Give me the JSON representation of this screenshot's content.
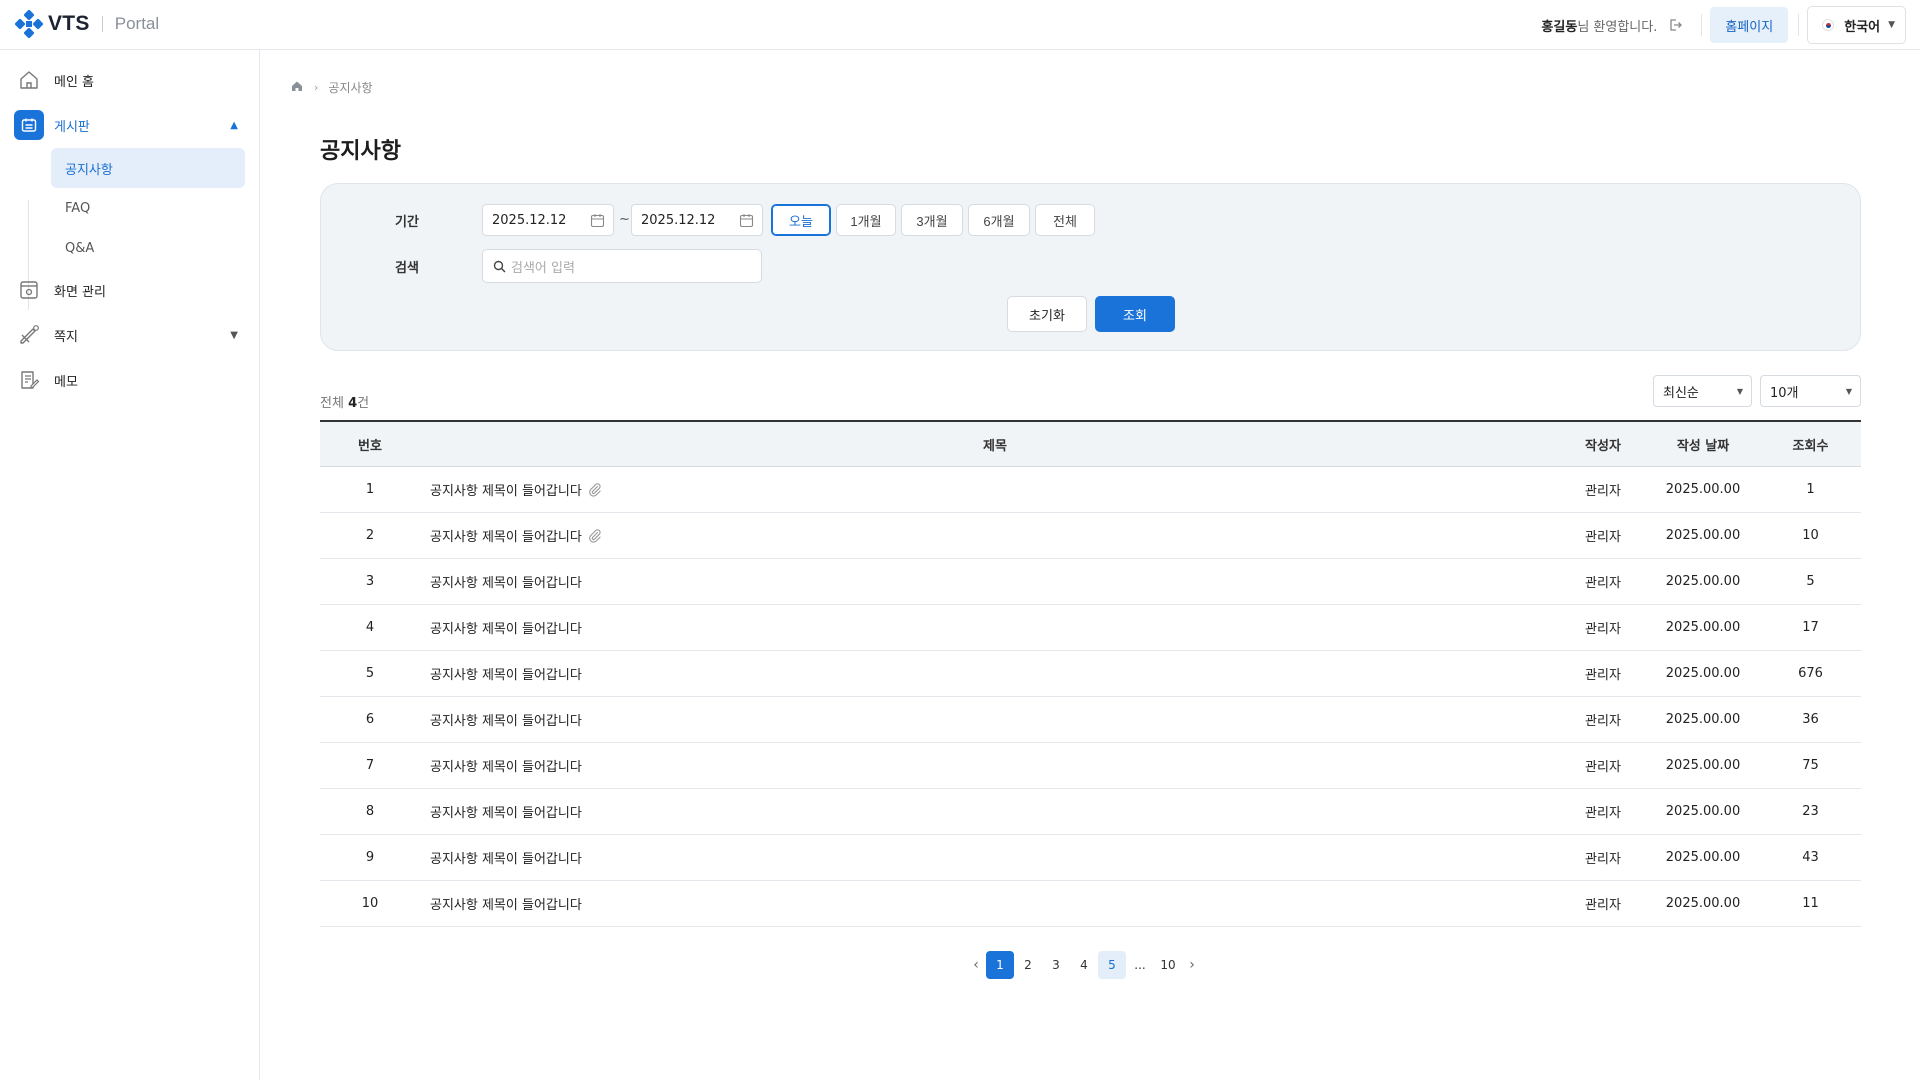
{
  "header": {
    "logo_text": "VTS",
    "logo_sub": "Portal",
    "user_name": "홍길동",
    "welcome_suffix": "님 환영합니다.",
    "homepage_label": "홈페이지",
    "language_label": "한국어"
  },
  "sidebar": {
    "items": [
      {
        "label": "메인 홈",
        "icon": "home-icon"
      },
      {
        "label": "게시판",
        "icon": "board-icon",
        "active": true,
        "expanded": true
      },
      {
        "label": "화면 관리",
        "icon": "screen-settings-icon"
      },
      {
        "label": "쪽지",
        "icon": "message-icon",
        "expanded": false
      },
      {
        "label": "메모",
        "icon": "memo-icon"
      }
    ],
    "sub_items": [
      {
        "label": "공지사항",
        "active": true
      },
      {
        "label": "FAQ"
      },
      {
        "label": "Q&A"
      }
    ]
  },
  "breadcrumb": {
    "current": "공지사항"
  },
  "page_title": "공지사항",
  "filter": {
    "period_label": "기간",
    "date_from": "2025.12.12",
    "date_to": "2025.12.12",
    "tilde": "~",
    "periods": [
      "오늘",
      "1개월",
      "3개월",
      "6개월",
      "전체"
    ],
    "active_period": "오늘",
    "search_label": "검색",
    "search_placeholder": "검색어 입력",
    "reset_label": "초기화",
    "search_button_label": "조회"
  },
  "list": {
    "total_prefix": "전체 ",
    "total_count": "4",
    "total_suffix": "건",
    "sort_value": "최신순",
    "page_size_value": "10개"
  },
  "table": {
    "headers": {
      "no": "번호",
      "title": "제목",
      "author": "작성자",
      "date": "작성 날짜",
      "views": "조회수"
    },
    "rows": [
      {
        "no": "1",
        "title": "공지사항 제목이 들어갑니다",
        "attachment": true,
        "author": "관리자",
        "date": "2025.00.00",
        "views": "1"
      },
      {
        "no": "2",
        "title": "공지사항 제목이 들어갑니다",
        "attachment": true,
        "author": "관리자",
        "date": "2025.00.00",
        "views": "10"
      },
      {
        "no": "3",
        "title": "공지사항 제목이 들어갑니다",
        "attachment": false,
        "author": "관리자",
        "date": "2025.00.00",
        "views": "5"
      },
      {
        "no": "4",
        "title": "공지사항 제목이 들어갑니다",
        "attachment": false,
        "author": "관리자",
        "date": "2025.00.00",
        "views": "17"
      },
      {
        "no": "5",
        "title": "공지사항 제목이 들어갑니다",
        "attachment": false,
        "author": "관리자",
        "date": "2025.00.00",
        "views": "676"
      },
      {
        "no": "6",
        "title": "공지사항 제목이 들어갑니다",
        "attachment": false,
        "author": "관리자",
        "date": "2025.00.00",
        "views": "36"
      },
      {
        "no": "7",
        "title": "공지사항 제목이 들어갑니다",
        "attachment": false,
        "author": "관리자",
        "date": "2025.00.00",
        "views": "75"
      },
      {
        "no": "8",
        "title": "공지사항 제목이 들어갑니다",
        "attachment": false,
        "author": "관리자",
        "date": "2025.00.00",
        "views": "23"
      },
      {
        "no": "9",
        "title": "공지사항 제목이 들어갑니다",
        "attachment": false,
        "author": "관리자",
        "date": "2025.00.00",
        "views": "43"
      },
      {
        "no": "10",
        "title": "공지사항 제목이 들어갑니다",
        "attachment": false,
        "author": "관리자",
        "date": "2025.00.00",
        "views": "11"
      }
    ]
  },
  "pagination": {
    "prev": "‹",
    "next": "›",
    "pages": [
      "1",
      "2",
      "3",
      "4",
      "5",
      "...",
      "10"
    ],
    "current": "1",
    "hovered": "5"
  },
  "colors": {
    "primary": "#1a73d9",
    "primary_light": "#e4eefa",
    "filter_bg": "#f1f4f7",
    "logo_blue": "#1a73d9"
  }
}
